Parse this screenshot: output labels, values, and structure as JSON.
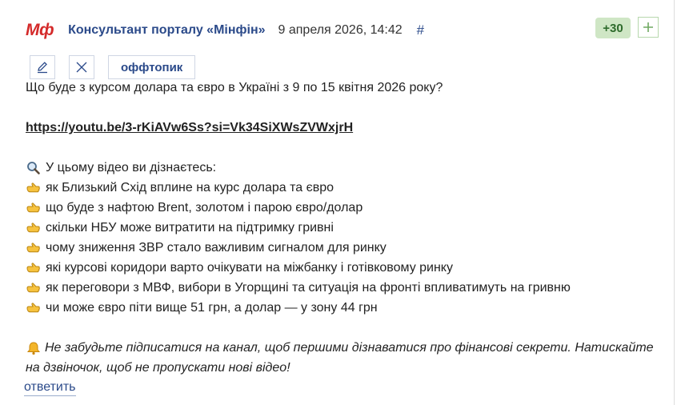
{
  "header": {
    "logo": "Мф",
    "author": "Консультант порталу «Мінфін»",
    "date": "9 апреля 2026, 14:42",
    "anchor": "#"
  },
  "rating": {
    "score": "+30",
    "plus_icon": "plus-icon"
  },
  "toolbar": {
    "edit_icon": "pencil-icon",
    "delete_icon": "close-icon",
    "tag": "оффтопик"
  },
  "post": {
    "question": "Що буде з курсом долара та євро в Україні з 9 по 15 квітня 2026 року?",
    "link": "https://youtu.be/3-rKiAVw6Ss?si=Vk34SiXWsZVWxjrH",
    "intro": "У цьому відео ви дізнаєтесь:",
    "intro_icon": "magnifier-icon",
    "bullet_icon": "pointing-hand-icon",
    "bullets": [
      "як Близький Схід вплине на курс долара та євро",
      "що буде з нафтою Brent, золотом і парою євро/долар",
      "скільки НБУ може витратити на підтримку гривні",
      "чому зниження ЗВР стало важливим сигналом для ринку",
      "які курсові коридори варто очікувати на міжбанку і готівковому ринку",
      "як переговори з МВФ, вибори в Угорщині та ситуація на фронті впливатимуть на гривню",
      "чи може євро піти вище 51 грн, а долар — у зону 44 грн"
    ],
    "cta_icon": "bell-icon",
    "cta": "Не забудьте підписатися на канал, щоб першими дізнаватися про фінансові секрети. Натискайте на дзвіночок, щоб не пропускати нові відео!"
  },
  "reply_label": "ответить",
  "colors": {
    "brand_red": "#d42a2a",
    "link_blue": "#2b4a8a",
    "score_bg": "#cfe6c5",
    "score_fg": "#2e6b2c"
  }
}
